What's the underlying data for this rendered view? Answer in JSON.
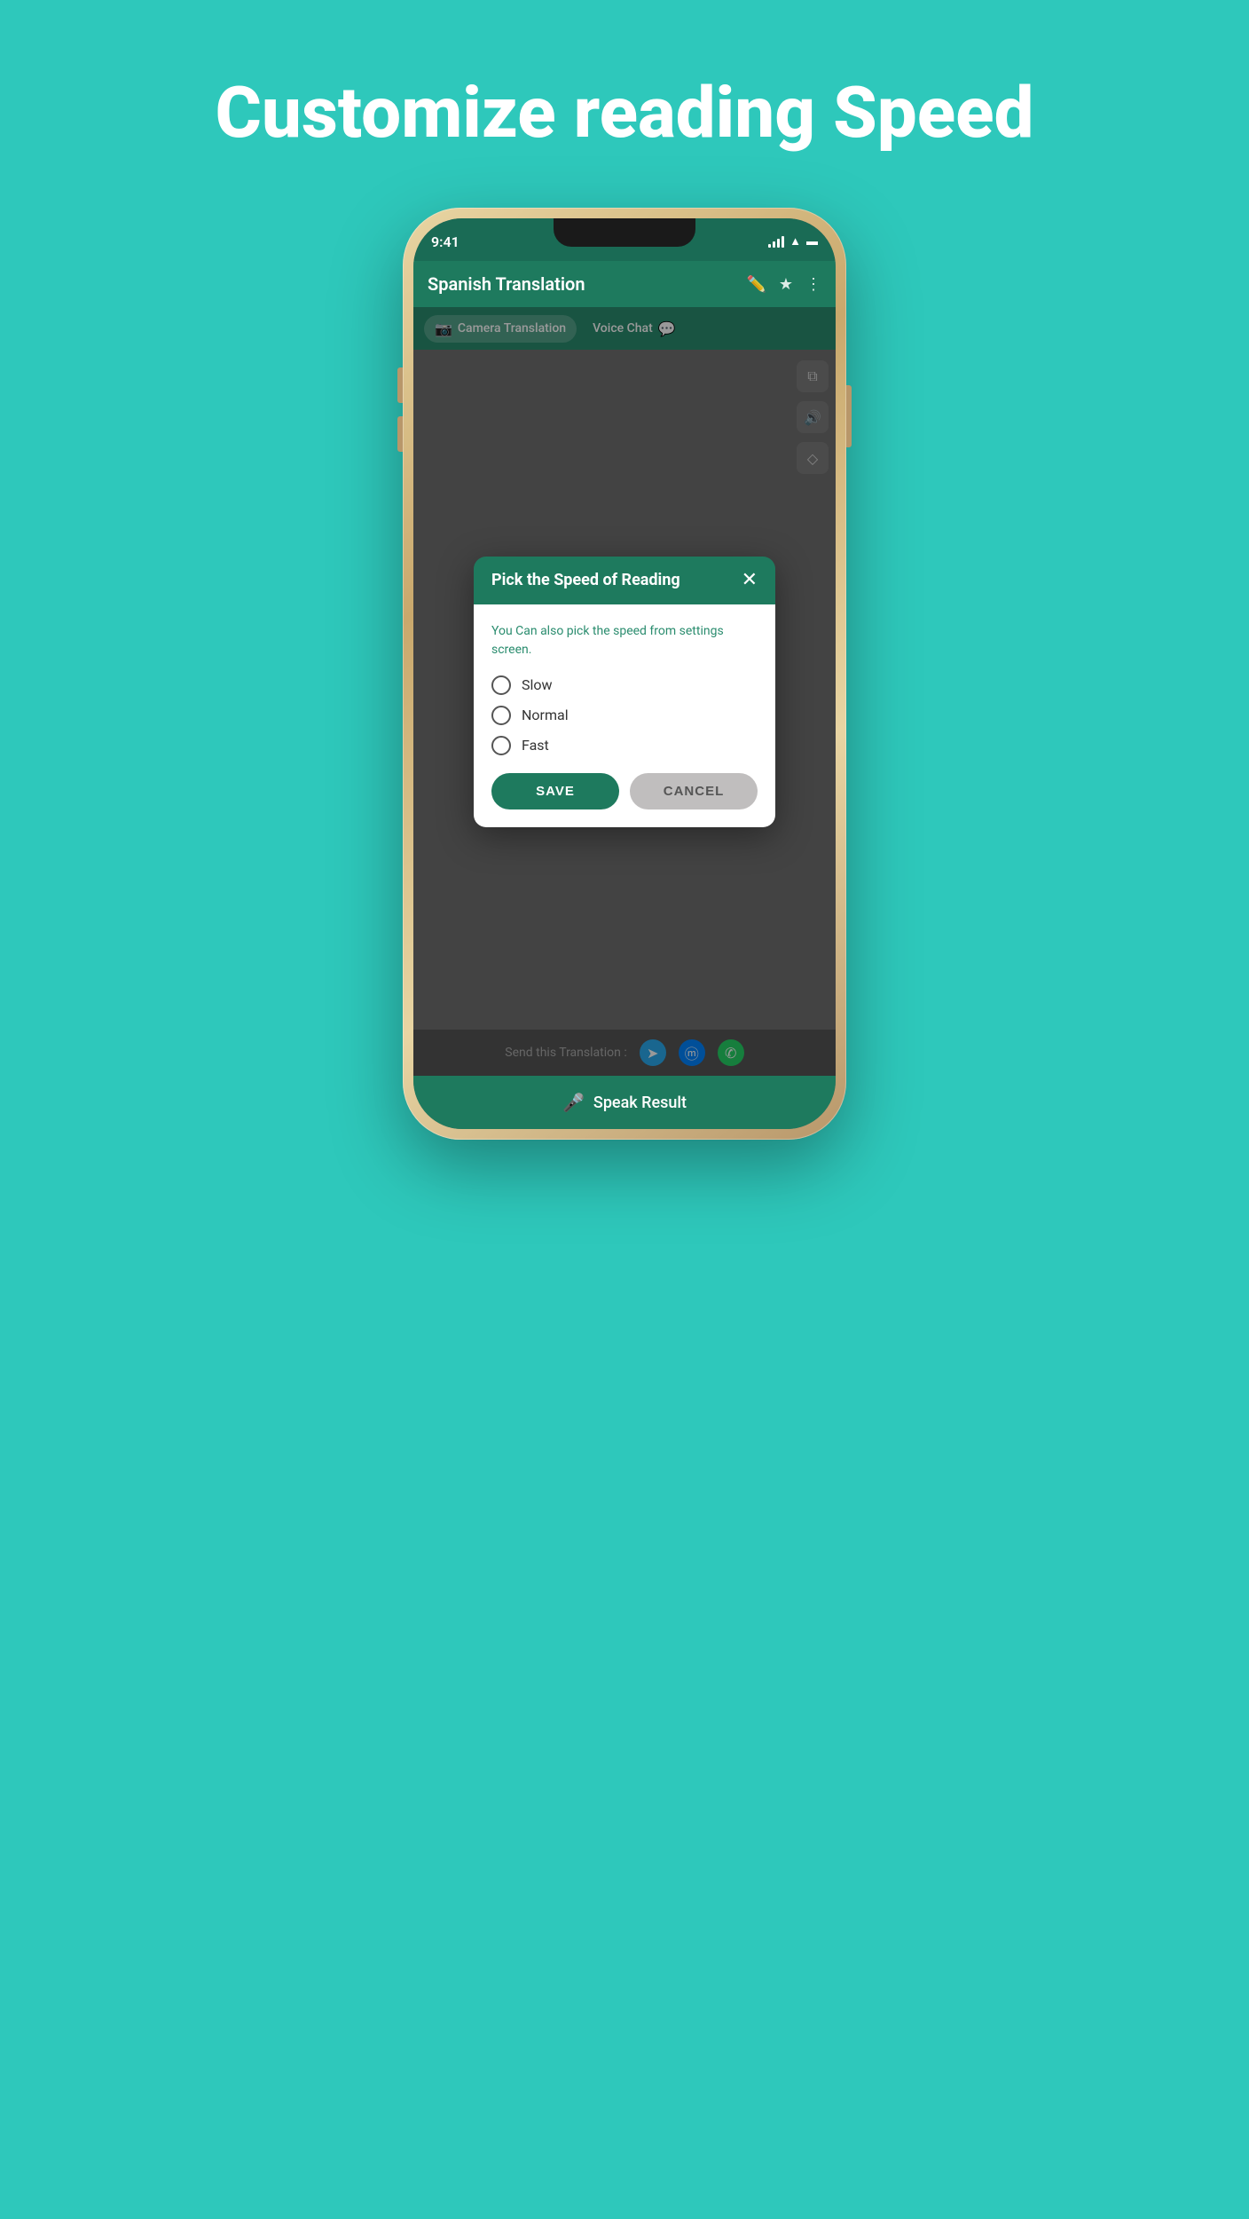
{
  "page": {
    "title": "Customize reading Speed",
    "background_color": "#2ec8bb"
  },
  "phone": {
    "status_bar": {
      "time": "9:41"
    },
    "app_header": {
      "title": "Spanish Translation"
    },
    "tabs": [
      {
        "label": "Camera Translation",
        "active": true,
        "icon": "📷"
      },
      {
        "label": "Voice Chat",
        "active": false,
        "icon": "💬"
      }
    ],
    "dialog": {
      "title": "Pick the Speed of Reading",
      "description": "You Can also pick the speed from settings screen.",
      "options": [
        {
          "label": "Slow",
          "selected": false
        },
        {
          "label": "Normal",
          "selected": false
        },
        {
          "label": "Fast",
          "selected": false
        }
      ],
      "save_button": "SAVE",
      "cancel_button": "CANCEL"
    },
    "bottom_bar": {
      "send_label": "Send this Translation :",
      "speak_label": "Speak Result"
    }
  }
}
